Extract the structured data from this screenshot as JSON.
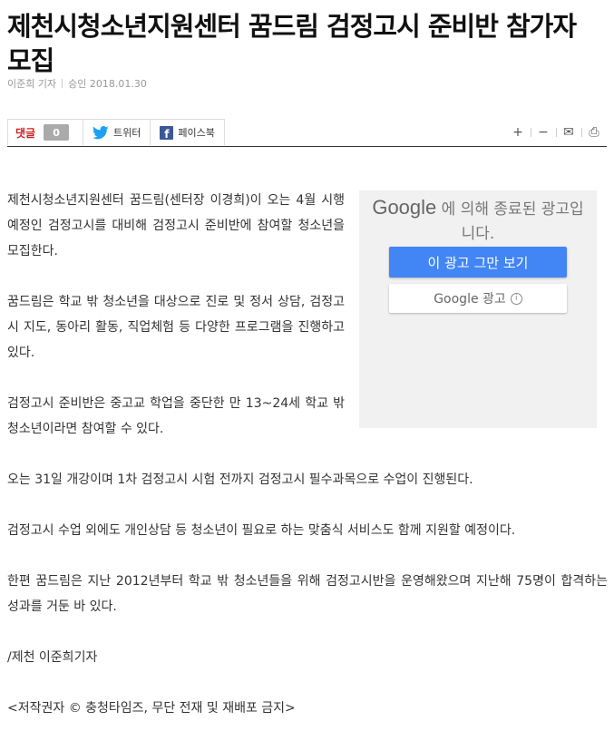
{
  "article": {
    "title": "제천시청소년지원센터 꿈드림 검정고시 준비반 참가자 모집",
    "reporter": "이준희 기자",
    "approved": "승인 2018.01.30",
    "paragraphs": [
      "제천시청소년지원센터 꿈드림(센터장 이경희)이 오는 4월 시행 예정인 검정고시를 대비해 검정고시 준비반에 참여할 청소년을 모집한다.",
      "꿈드림은 학교 밖 청소년을 대상으로 진로 및 정서 상담, 검정고시 지도, 동아리 활동, 직업체험 등 다양한 프로그램을 진행하고 있다.",
      "검정고시 준비반은 중고교 학업을 중단한 만 13~24세 학교 밖 청소년이라면 참여할 수 있다.",
      "오는 31일 개강이며 1차 검정고시 시험 전까지 검정고시 필수과목으로 수업이 진행된다.",
      "검정고시 수업 외에도 개인상담 등 청소년이 필요로 하는 맞춤식 서비스도 함께 지원할 예정이다.",
      "한편 꿈드림은 지난 2012년부터 학교 밖 청소년들을 위해 검정고시반을 운영해왔으며 지난해 75명이 합격하는 성과를 거둔 바 있다.",
      "/제천 이준희기자",
      "<저작권자 © 충청타임즈, 무단 전재 및 재배포 금지>"
    ]
  },
  "share": {
    "comment_label": "댓글",
    "comment_count": "0",
    "twitter_label": "트위터",
    "facebook_label": "페이스북"
  },
  "tools": {
    "plus": "+",
    "minus": "−",
    "mail": "✉",
    "print": "⎙"
  },
  "ad": {
    "google": "Google",
    "closed_text": " 에 의해 종료된 광고입니다.",
    "stop_label": "이 광고 그만 보기",
    "info_label": "Google 광고",
    "info_icon": "i"
  },
  "colors": {
    "comment": "#d02020",
    "twitter": "#1da1f2",
    "facebook": "#3b5998",
    "ad_button": "#4285f4"
  }
}
